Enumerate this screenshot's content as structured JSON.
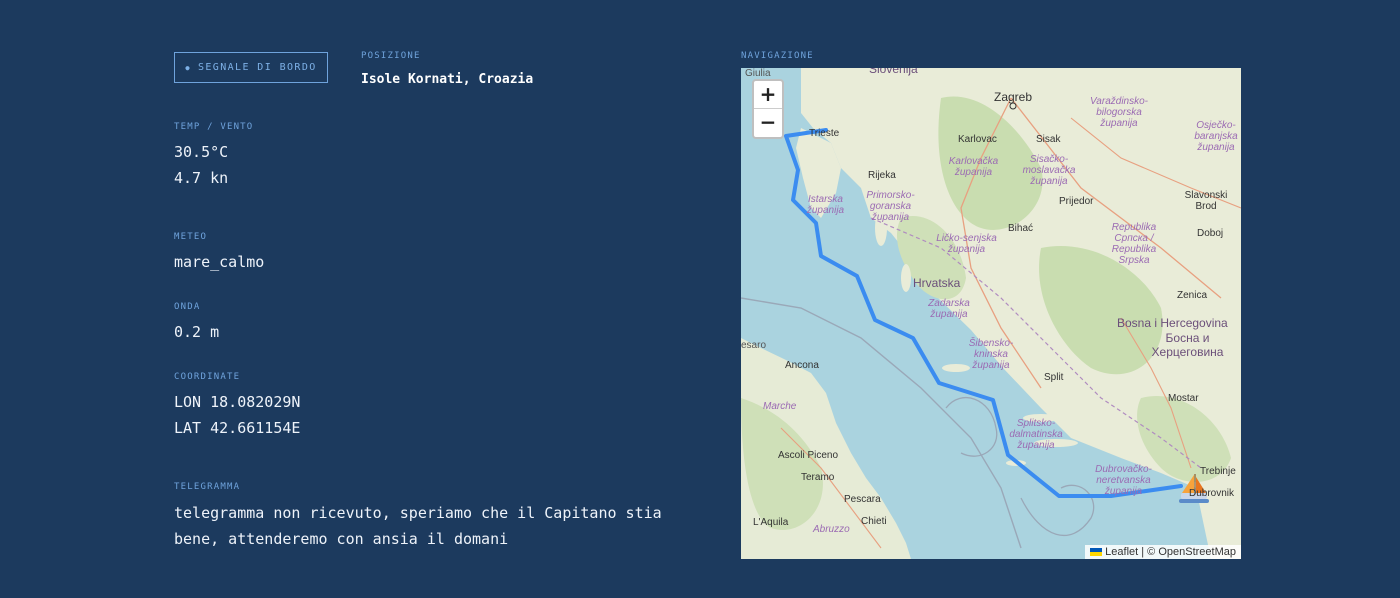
{
  "status": {
    "badge": "SEGNALE DI BORDO",
    "dot": "●"
  },
  "position": {
    "label": "POSIZIONE",
    "value": "Isole Kornati, Croazia"
  },
  "weather": {
    "temp_wind_label": "TEMP / VENTO",
    "temp": "30.5°C",
    "wind": "4.7 kn",
    "meteo_label": "METEO",
    "meteo": "mare_calmo",
    "wave_label": "ONDA",
    "wave": "0.2 m"
  },
  "coordinates": {
    "label": "COORDINATE",
    "lon": "LON 18.082029N",
    "lat": "LAT 42.661154E"
  },
  "telegram": {
    "label": "TELEGRAMMA",
    "text": "telegramma non ricevuto, speriamo che il Capitano stia bene, attenderemo con ansia il domani"
  },
  "navigation": {
    "label": "NAVIGAZIONE",
    "zoom_in": "+",
    "zoom_out": "−",
    "attribution_leaflet": "Leaflet",
    "attribution_sep": " | © ",
    "attribution_osm": "OpenStreetMap",
    "route_color": "#3b8cf0",
    "places": {
      "slovenija": "Slovenija",
      "zagreb": "Zagreb",
      "trieste": "Trieste",
      "rijeka": "Rijeka",
      "karlovac": "Karlovac",
      "sisak": "Sisak",
      "hrvatska": "Hrvatska",
      "prijedor": "Prijedor",
      "bihac": "Bihać",
      "split": "Split",
      "ancona": "Ancona",
      "pescara": "Pescara",
      "chieti": "Chieti",
      "teramo": "Teramo",
      "ascoli": "Ascoli Piceno",
      "marche": "Marche",
      "abruzzo": "Abruzzo",
      "aquila": "L'Aquila",
      "bosna": "Bosna i Hercegovina",
      "bosna_cyr": "Босна и Херцеговина",
      "mostar": "Mostar",
      "zenica": "Zenica",
      "trebinje": "Trebinje",
      "doboj": "Doboj",
      "slavonski": "Slavonski Brod",
      "giulia": "Giulia",
      "esaro": "esaro",
      "istarska": "Istarska županija",
      "primorsko": "Primorsko-goranska županija",
      "licko": "Ličko-senjska županija",
      "zadarska": "Zadarska županija",
      "sibensko": "Šibensko-kninska županija",
      "splitsko": "Splitsko-dalmatinska županija",
      "dubrovacko": "Dubrovačko-neretvanska županija",
      "karlovacka": "Karlovačka županija",
      "sisacko": "Sisačko-moslavačka županija",
      "varazdin": "Varaždinsko-bilogorska županija",
      "osjecko": "Osječko-baranjska županija",
      "srpska": "Republika Српска / Republika Srpska",
      "dubrovnik": "Dubrovnik"
    }
  }
}
